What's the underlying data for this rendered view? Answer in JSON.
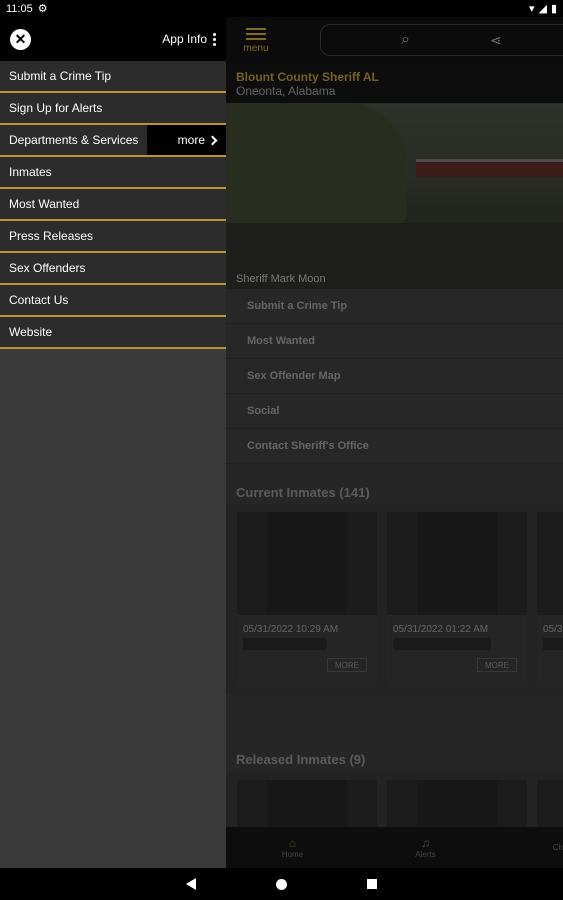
{
  "status": {
    "time": "11:05"
  },
  "topbar": {
    "menu_label": "menu"
  },
  "header": {
    "title": "Blount County Sheriff AL",
    "location": "Oneonta, Alabama"
  },
  "hero": {
    "caption": "Sheriff Mark Moon"
  },
  "quick_links": [
    "Submit a Crime Tip",
    "Most Wanted",
    "Sex Offender Map",
    "Social",
    "Contact Sheriff's Office"
  ],
  "current_inmates": {
    "title": "Current Inmates (141)",
    "cards": [
      {
        "date": "05/31/2022 10:29 AM",
        "more": "MORE"
      },
      {
        "date": "05/31/2022 01:22 AM",
        "more": "MORE"
      },
      {
        "date": "05/3"
      }
    ]
  },
  "released_inmates": {
    "title": "Released Inmates (9)"
  },
  "bottom_nav": {
    "home": "Home",
    "alerts": "Alerts",
    "third": "Ch"
  },
  "drawer": {
    "app_info": "App Info",
    "items": [
      "Submit a Crime Tip",
      "Sign Up for Alerts",
      "Departments & Services",
      "Inmates",
      "Most Wanted",
      "Press Releases",
      "Sex Offenders",
      "Contact Us",
      "Website"
    ],
    "more_label": "more"
  },
  "colors": {
    "accent": "#b8962e",
    "drawer_bg": "#2c2c2c"
  }
}
